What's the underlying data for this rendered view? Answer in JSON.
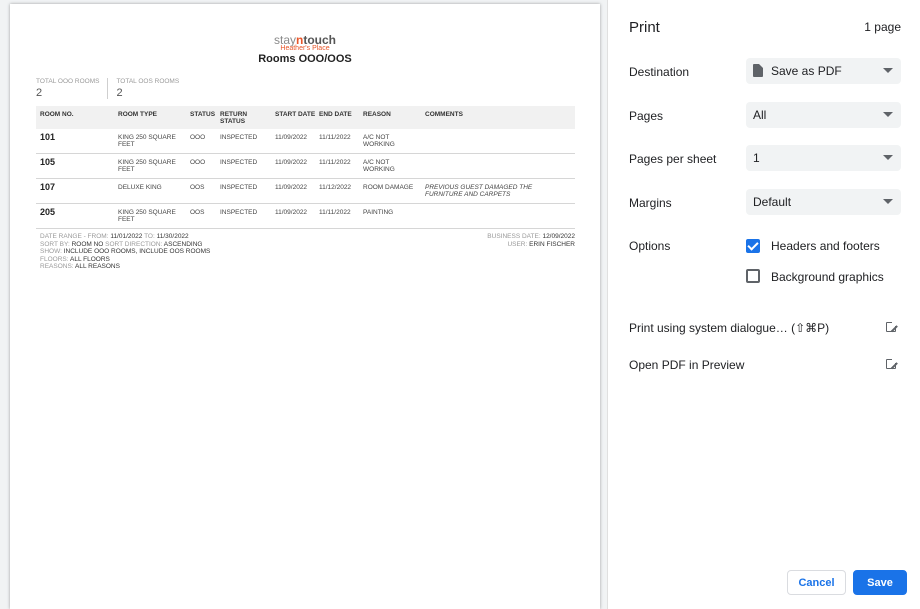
{
  "report": {
    "logo": {
      "part1": "stay",
      "part2": "n",
      "part3": "touch"
    },
    "hotel": "Heather's Place",
    "title": "Rooms OOO/OOS",
    "totals": [
      {
        "label": "TOTAL OOO ROOMS",
        "value": "2"
      },
      {
        "label": "TOTAL OOS ROOMS",
        "value": "2"
      }
    ],
    "columns": [
      "ROOM NO.",
      "ROOM TYPE",
      "STATUS",
      "RETURN STATUS",
      "START DATE",
      "END DATE",
      "REASON",
      "COMMENTS"
    ],
    "rows": [
      {
        "room": "101",
        "type": "KING 250 SQUARE FEET",
        "status": "OOO",
        "ret": "INSPECTED",
        "start": "11/09/2022",
        "end": "11/11/2022",
        "reason": "A/C NOT WORKING",
        "comment": ""
      },
      {
        "room": "105",
        "type": "KING 250 SQUARE FEET",
        "status": "OOO",
        "ret": "INSPECTED",
        "start": "11/09/2022",
        "end": "11/11/2022",
        "reason": "A/C NOT WORKING",
        "comment": ""
      },
      {
        "room": "107",
        "type": "DELUXE KING",
        "status": "OOS",
        "ret": "INSPECTED",
        "start": "11/09/2022",
        "end": "11/12/2022",
        "reason": "ROOM DAMAGE",
        "comment": "PREVIOUS GUEST DAMAGED THE FURNITURE AND CARPETS"
      },
      {
        "room": "205",
        "type": "KING 250 SQUARE FEET",
        "status": "OOS",
        "ret": "INSPECTED",
        "start": "11/09/2022",
        "end": "11/11/2022",
        "reason": "PAINTING",
        "comment": ""
      }
    ],
    "filters": {
      "date_range_label": "DATE RANGE - FROM:",
      "from": "11/01/2022",
      "to_label": "TO:",
      "to": "11/30/2022",
      "sort_by_label": "SORT BY:",
      "sort_by": "ROOM NO",
      "sort_dir_label": "SORT DIRECTION:",
      "sort_dir": "ASCENDING",
      "show_label": "SHOW:",
      "show": "INCLUDE OOO ROOMS, INCLUDE OOS ROOMS",
      "floors_label": "FLOORS:",
      "floors": "ALL FLOORS",
      "reasons_label": "REASONS:",
      "reasons": "ALL REASONS"
    },
    "business_date_label": "BUSINESS DATE:",
    "business_date": "12/09/2022",
    "user_label": "USER:",
    "user": "ERIN FISCHER"
  },
  "print": {
    "title": "Print",
    "page_count": "1 page",
    "destination_label": "Destination",
    "destination_value": "Save as PDF",
    "pages_label": "Pages",
    "pages_value": "All",
    "pps_label": "Pages per sheet",
    "pps_value": "1",
    "margins_label": "Margins",
    "margins_value": "Default",
    "options_label": "Options",
    "headers_footers": "Headers and footers",
    "headers_footers_checked": true,
    "background_graphics": "Background graphics",
    "background_graphics_checked": false,
    "system_dialogue": "Print using system dialogue… (⇧⌘P)",
    "open_pdf": "Open PDF in Preview",
    "cancel": "Cancel",
    "save": "Save",
    "accent_color": "#1a73e8"
  }
}
